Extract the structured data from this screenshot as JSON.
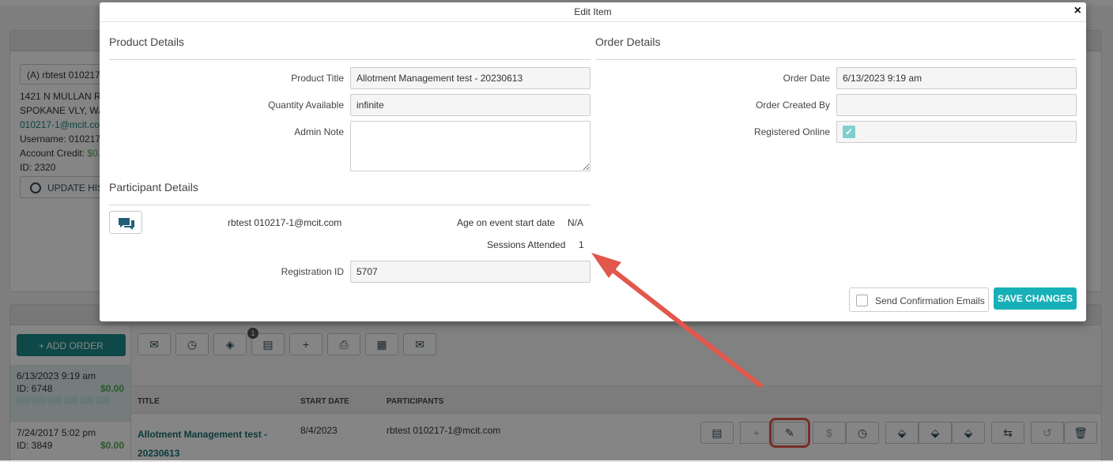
{
  "account": {
    "select_value": "(A) rbtest 010217",
    "address1": "1421 N MULLAN RD",
    "address2": "SPOKANE VLY, WA",
    "email": "010217-1@mcit.com",
    "username": "Username: 010217-",
    "credit_label": "Account Credit: ",
    "credit_value": "$0.",
    "id": "ID: 2320",
    "update_btn": "UPDATE HIS"
  },
  "orders": {
    "add_order": "+  ADD ORDER",
    "toolbar_badge": "1",
    "side_items": [
      {
        "date": "6/13/2023 9:19 am",
        "id": "ID: 6748",
        "amount": "$0.00"
      },
      {
        "date": "7/24/2017 5:02 pm",
        "id": "ID: 3849",
        "amount": "$0.00"
      }
    ],
    "columns": {
      "title": "TITLE",
      "start_date": "START DATE",
      "participants": "PARTICIPANTS"
    },
    "row": {
      "title": "Allotment Management test - 20230613",
      "start_date": "8/4/2023",
      "participant": "rbtest 010217-1@mcit.com"
    }
  },
  "modal": {
    "title": "Edit Item",
    "close": "×",
    "product_details": {
      "heading": "Product Details",
      "product_title_label": "Product Title",
      "product_title_value": "Allotment Management test - 20230613",
      "qty_label": "Quantity Available",
      "qty_value": "infinite",
      "admin_note_label": "Admin Note",
      "admin_note_value": ""
    },
    "order_details": {
      "heading": "Order Details",
      "order_date_label": "Order Date",
      "order_date_value": "6/13/2023 9:19 am",
      "created_by_label": "Order Created By",
      "created_by_value": "",
      "registered_online_label": "Registered Online",
      "registered_online_checked": true
    },
    "participant_details": {
      "heading": "Participant Details",
      "participant_email": "rbtest 010217-1@mcit.com",
      "age_label": "Age on event start date",
      "age_value": "N/A",
      "sessions_label": "Sessions Attended",
      "sessions_value": "1",
      "reg_id_label": "Registration ID",
      "reg_id_value": "5707"
    },
    "send_confirmation_label": "Send Confirmation Emails",
    "save_button": "SAVE CHANGES"
  },
  "colors": {
    "accent": "#17b0b8",
    "teal_dark": "#1e8a8a",
    "highlight": "#e2574c",
    "money_green": "#4caf50"
  }
}
